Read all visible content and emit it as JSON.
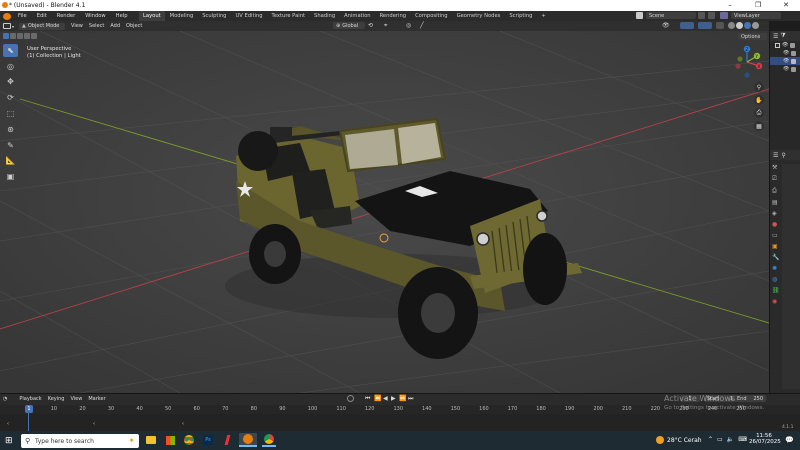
{
  "window": {
    "title": "* (Unsaved) - Blender 4.1",
    "minimize": "–",
    "maximize": "❐",
    "close": "✕"
  },
  "menu": [
    "File",
    "Edit",
    "Render",
    "Window",
    "Help"
  ],
  "workspaces": [
    "Layout",
    "Modeling",
    "Sculpting",
    "UV Editing",
    "Texture Paint",
    "Shading",
    "Animation",
    "Rendering",
    "Compositing",
    "Geometry Nodes",
    "Scripting",
    "+"
  ],
  "active_workspace": "Layout",
  "scene": "Scene",
  "view_layer": "ViewLayer",
  "header": {
    "mode": "Object Mode",
    "view": "View",
    "select": "Select",
    "add": "Add",
    "object": "Object",
    "orientation": "Global",
    "options": "Options"
  },
  "viewport": {
    "perspective": "User Perspective",
    "collection": "(1) Collection | Light"
  },
  "gizmo_axes": {
    "x": "X",
    "y": "Y",
    "z": "Z"
  },
  "timeline": {
    "playback": "Playback",
    "keying": "Keying",
    "view": "View",
    "marker": "Marker",
    "start_label": "Start",
    "start": "1",
    "end_label": "End",
    "end": "250",
    "current_frame": "1",
    "ticks": [
      "1",
      "10",
      "20",
      "30",
      "40",
      "50",
      "60",
      "70",
      "80",
      "90",
      "100",
      "110",
      "120",
      "130",
      "140",
      "150",
      "160",
      "170",
      "180",
      "190",
      "200",
      "210",
      "220",
      "230",
      "240",
      "250"
    ]
  },
  "watermark": {
    "line1": "Activate Windows",
    "line2": "Go to Settings to activate Windows."
  },
  "version": "4.1.1",
  "taskbar": {
    "search_placeholder": "Type here to search",
    "weather": "28°C Cerah",
    "time": "11:56",
    "date": "26/07/2025"
  },
  "colors": {
    "accent": "#4772b3",
    "x_axis": "#d63b47",
    "y_axis": "#8bbf2a",
    "z_axis": "#2d7fd6",
    "jeep": "#6b6530"
  }
}
